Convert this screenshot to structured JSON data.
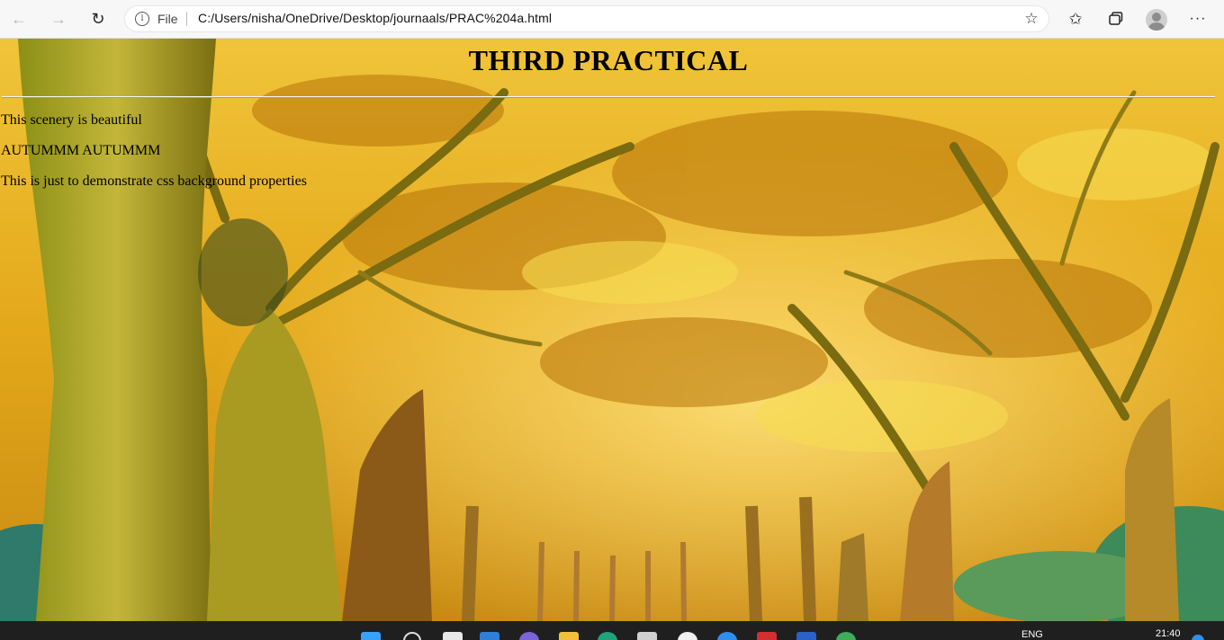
{
  "browser": {
    "scheme_label": "File",
    "url": "C:/Users/nisha/OneDrive/Desktop/journaals/PRAC%204a.html",
    "icons": [
      "back-arrow-icon",
      "forward-arrow-icon",
      "refresh-icon",
      "info-icon",
      "add-favorite-icon",
      "favorites-icon",
      "collections-icon",
      "profile-avatar",
      "more-menu-icon"
    ]
  },
  "page": {
    "heading": "THIRD PRACTICAL",
    "lines": [
      "This scenery is beautiful",
      "AUTUMMM AUTUMMM",
      "This is just to demonstrate css background properties"
    ],
    "colors": {
      "text": "#000000",
      "canopy": "#e0a516",
      "trunk": "#a8a21e"
    }
  },
  "taskbar": {
    "language": "ENG",
    "time": "21:40",
    "apps": [
      "start-icon",
      "search-icon",
      "task-view-icon",
      "widgets-icon",
      "teams-chat-icon",
      "file-explorer-icon",
      "edge-icon",
      "store-icon",
      "chrome-icon",
      "app-icon",
      "mail-icon",
      "word-icon",
      "browser-globe-icon"
    ]
  }
}
